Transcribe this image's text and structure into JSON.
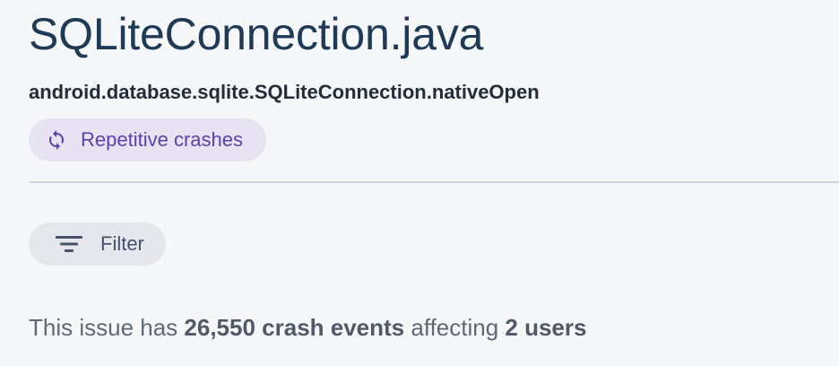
{
  "issue": {
    "title": "SQLiteConnection.java",
    "method": "android.database.sqlite.SQLiteConnection.nativeOpen",
    "badge": {
      "label": "Repetitive crashes",
      "icon": "sync-icon",
      "color": "#5e3fb0",
      "background": "#e7e3f3"
    }
  },
  "filter": {
    "label": "Filter",
    "icon": "filter-list-icon"
  },
  "summary": {
    "prefix": "This issue has ",
    "events": "26,550 crash events",
    "middle": " affecting ",
    "users": "2 users"
  }
}
